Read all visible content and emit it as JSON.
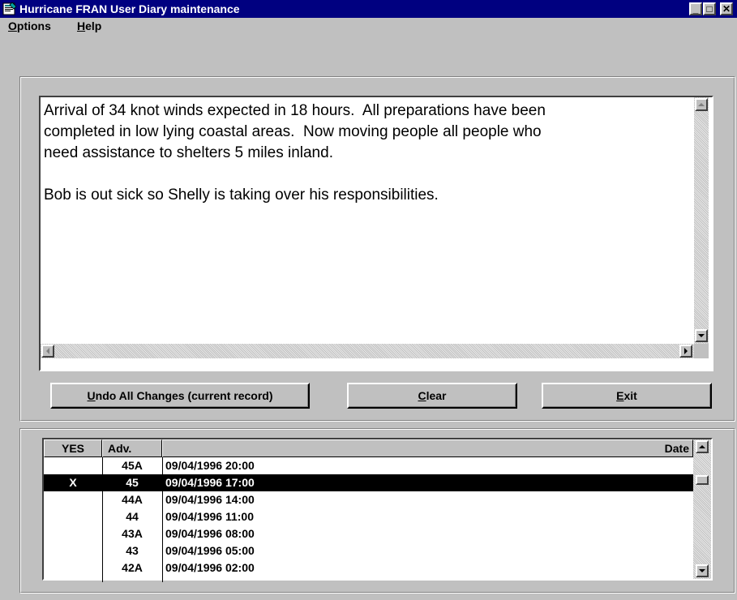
{
  "window": {
    "title": "Hurricane FRAN User Diary maintenance",
    "minimize_label": "_",
    "maximize_label": "□",
    "close_label": "✕"
  },
  "menu": {
    "options_mnemonic": "O",
    "options_rest": "ptions",
    "help_mnemonic": "H",
    "help_rest": "elp"
  },
  "diary": {
    "text": "Arrival of 34 knot winds expected in 18 hours.  All preparations have been\ncompleted in low lying coastal areas.  Now moving people all people who\nneed assistance to shelters 5 miles inland.\n\nBob is out sick so Shelly is taking over his responsibilities."
  },
  "buttons": {
    "undo_mnemonic": "U",
    "undo_rest": "ndo All Changes (current record)",
    "clear_mnemonic": "C",
    "clear_rest": "lear",
    "exit_mnemonic": "E",
    "exit_rest": "xit"
  },
  "grid": {
    "headers": {
      "yes": "YES",
      "adv": "Adv.",
      "date": "Date"
    },
    "rows": [
      {
        "yes": "",
        "adv": "45A",
        "date": "09/04/1996 20:00",
        "selected": false
      },
      {
        "yes": "X",
        "adv": "45",
        "date": "09/04/1996 17:00",
        "selected": true
      },
      {
        "yes": "",
        "adv": "44A",
        "date": "09/04/1996 14:00",
        "selected": false
      },
      {
        "yes": "",
        "adv": "44",
        "date": "09/04/1996 11:00",
        "selected": false
      },
      {
        "yes": "",
        "adv": "43A",
        "date": "09/04/1996 08:00",
        "selected": false
      },
      {
        "yes": "",
        "adv": "43",
        "date": "09/04/1996 05:00",
        "selected": false
      },
      {
        "yes": "",
        "adv": "42A",
        "date": "09/04/1996 02:00",
        "selected": false
      }
    ]
  },
  "colors": {
    "titlebar": "#000080",
    "face": "#c0c0c0",
    "selection": "#000000"
  }
}
